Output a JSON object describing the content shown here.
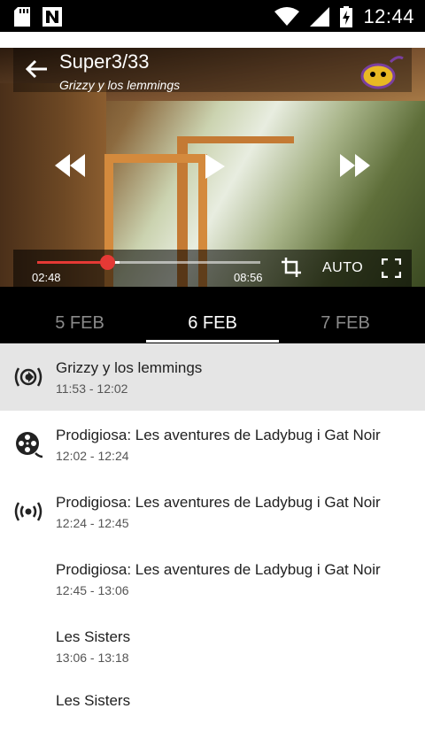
{
  "status_bar": {
    "time": "12:44",
    "icons": [
      "sd-card-icon",
      "n-notification-icon",
      "wifi-icon",
      "signal-icon",
      "battery-charging-icon"
    ]
  },
  "player": {
    "title": "Super3/33",
    "subtitle": "Grizzy y los lemmings",
    "current_time": "02:48",
    "duration": "08:56",
    "progress": 0.313,
    "buffered": 0.37,
    "quality_label": "AUTO",
    "accent_color": "#e53935"
  },
  "tabs": [
    {
      "label": "5 FEB",
      "active": false
    },
    {
      "label": "6 FEB",
      "active": true
    },
    {
      "label": "7 FEB",
      "active": false
    }
  ],
  "schedule": [
    {
      "title": "Grizzy y los lemmings",
      "time": "11:53 - 12:02",
      "icon": "live-broadcast-icon",
      "selected": true
    },
    {
      "title": "Prodigiosa: Les aventures de Ladybug i Gat Noir",
      "time": "12:02 - 12:24",
      "icon": "film-reel-icon",
      "selected": false
    },
    {
      "title": "Prodigiosa: Les aventures de Ladybug i Gat Noir",
      "time": "12:24 - 12:45",
      "icon": "broadcast-icon",
      "selected": false
    },
    {
      "title": "Prodigiosa: Les aventures de Ladybug i Gat Noir",
      "time": "12:45 - 13:06",
      "icon": "",
      "selected": false
    },
    {
      "title": "Les Sisters",
      "time": "13:06 - 13:18",
      "icon": "",
      "selected": false
    },
    {
      "title": "Les Sisters",
      "time": "",
      "icon": "",
      "selected": false
    }
  ]
}
